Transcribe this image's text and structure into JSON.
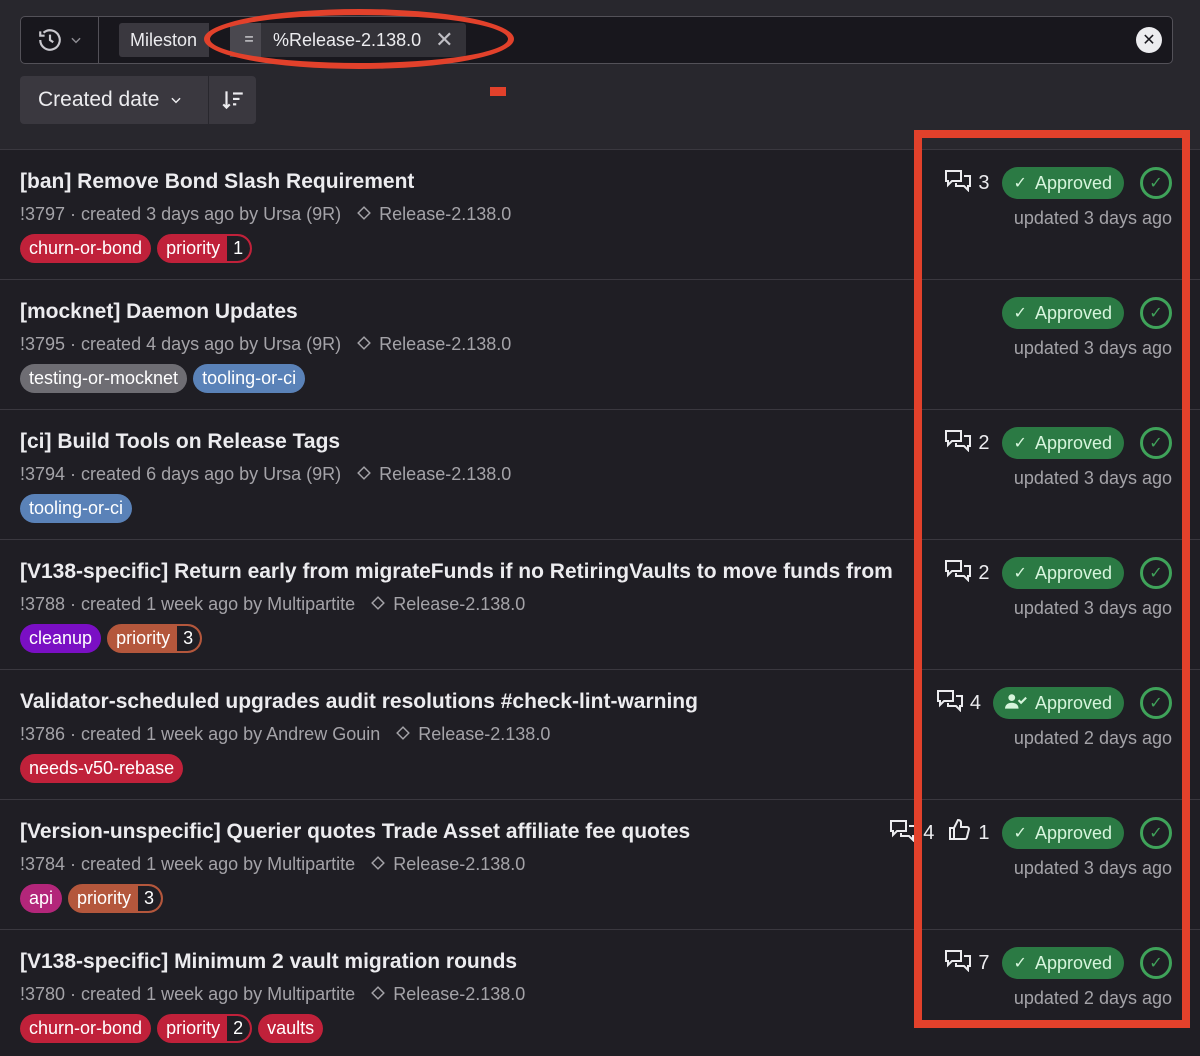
{
  "filter": {
    "field": "Mileston",
    "operator": "=",
    "value": "%Release-2.138.0"
  },
  "sort": {
    "label": "Created date"
  },
  "colors": {
    "annotation": "#e2412b",
    "approved_bg": "#2b7a44",
    "pipeline_success": "#3fa35a"
  },
  "merge_requests": [
    {
      "title": "[ban] Remove Bond Slash Requirement",
      "meta": "!3797 · created 3 days ago by Ursa (9R)",
      "milestone": "Release-2.138.0",
      "labels": [
        {
          "text": "churn-or-bond",
          "color": "#c0213a"
        },
        {
          "text": "priority",
          "value": "1",
          "color": "#c0213a"
        }
      ],
      "comments": "3",
      "thumbs": "",
      "approval": "Approved",
      "updated": "updated 3 days ago"
    },
    {
      "title": "[mocknet] Daemon Updates",
      "meta": "!3795 · created 4 days ago by Ursa (9R)",
      "milestone": "Release-2.138.0",
      "labels": [
        {
          "text": "testing-or-mocknet",
          "color": "#6e6d73"
        },
        {
          "text": "tooling-or-ci",
          "color": "#5a82b8"
        }
      ],
      "comments": "",
      "thumbs": "",
      "approval": "Approved",
      "updated": "updated 3 days ago"
    },
    {
      "title": "[ci] Build Tools on Release Tags",
      "meta": "!3794 · created 6 days ago by Ursa (9R)",
      "milestone": "Release-2.138.0",
      "labels": [
        {
          "text": "tooling-or-ci",
          "color": "#5a82b8"
        }
      ],
      "comments": "2",
      "thumbs": "",
      "approval": "Approved",
      "updated": "updated 3 days ago"
    },
    {
      "title": "[V138-specific] Return early from migrateFunds if no RetiringVaults to move funds from",
      "meta": "!3788 · created 1 week ago by Multipartite",
      "milestone": "Release-2.138.0",
      "labels": [
        {
          "text": "cleanup",
          "color": "#7a0fc4"
        },
        {
          "text": "priority",
          "value": "3",
          "color": "#b4573c"
        }
      ],
      "comments": "2",
      "thumbs": "",
      "approval": "Approved",
      "updated": "updated 3 days ago"
    },
    {
      "title": "Validator-scheduled upgrades audit resolutions #check-lint-warning",
      "meta": "!3786 · created 1 week ago by Andrew Gouin",
      "milestone": "Release-2.138.0",
      "labels": [
        {
          "text": "needs-v50-rebase",
          "color": "#c0213a"
        }
      ],
      "comments": "4",
      "thumbs": "",
      "approval": "Approved",
      "approval_icon": "user-check-icon",
      "updated": "updated 2 days ago"
    },
    {
      "title": "[Version-unspecific] Querier quotes Trade Asset affiliate fee quotes",
      "meta": "!3784 · created 1 week ago by Multipartite",
      "milestone": "Release-2.138.0",
      "labels": [
        {
          "text": "api",
          "color": "#b3267a"
        },
        {
          "text": "priority",
          "value": "3",
          "color": "#b4573c"
        }
      ],
      "comments": "4",
      "thumbs": "1",
      "approval": "Approved",
      "updated": "updated 3 days ago"
    },
    {
      "title": "[V138-specific] Minimum 2 vault migration rounds",
      "meta": "!3780 · created 1 week ago by Multipartite",
      "milestone": "Release-2.138.0",
      "labels": [
        {
          "text": "churn-or-bond",
          "color": "#c0213a"
        },
        {
          "text": "priority",
          "value": "2",
          "color": "#c0213a"
        },
        {
          "text": "vaults",
          "color": "#c0213a"
        }
      ],
      "comments": "7",
      "thumbs": "",
      "approval": "Approved",
      "updated": "updated 2 days ago"
    }
  ]
}
